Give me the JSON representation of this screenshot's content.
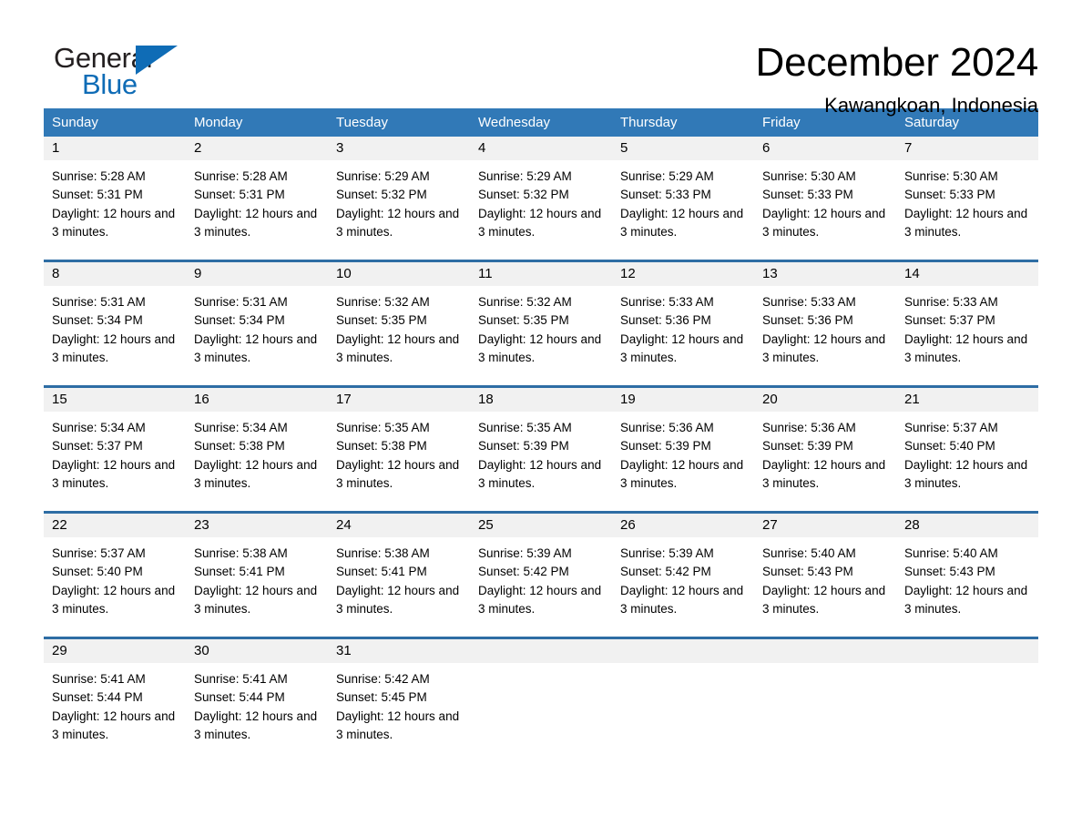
{
  "brand": {
    "name_part1": "General",
    "name_part2": "Blue",
    "triangle_color": "#0f6cb6"
  },
  "header": {
    "month_title": "December 2024",
    "location": "Kawangkoan, Indonesia"
  },
  "theme": {
    "header_blue": "#3179b7",
    "row_divider_blue": "#2e6da4",
    "date_band_gray": "#f1f1f1",
    "brand_blue": "#0f6cb6"
  },
  "calendar": {
    "day_headers": [
      "Sunday",
      "Monday",
      "Tuesday",
      "Wednesday",
      "Thursday",
      "Friday",
      "Saturday"
    ],
    "weeks": [
      {
        "days": [
          {
            "num": "1",
            "sunrise": "Sunrise: 5:28 AM",
            "sunset": "Sunset: 5:31 PM",
            "daylight": "Daylight: 12 hours and 3 minutes."
          },
          {
            "num": "2",
            "sunrise": "Sunrise: 5:28 AM",
            "sunset": "Sunset: 5:31 PM",
            "daylight": "Daylight: 12 hours and 3 minutes."
          },
          {
            "num": "3",
            "sunrise": "Sunrise: 5:29 AM",
            "sunset": "Sunset: 5:32 PM",
            "daylight": "Daylight: 12 hours and 3 minutes."
          },
          {
            "num": "4",
            "sunrise": "Sunrise: 5:29 AM",
            "sunset": "Sunset: 5:32 PM",
            "daylight": "Daylight: 12 hours and 3 minutes."
          },
          {
            "num": "5",
            "sunrise": "Sunrise: 5:29 AM",
            "sunset": "Sunset: 5:33 PM",
            "daylight": "Daylight: 12 hours and 3 minutes."
          },
          {
            "num": "6",
            "sunrise": "Sunrise: 5:30 AM",
            "sunset": "Sunset: 5:33 PM",
            "daylight": "Daylight: 12 hours and 3 minutes."
          },
          {
            "num": "7",
            "sunrise": "Sunrise: 5:30 AM",
            "sunset": "Sunset: 5:33 PM",
            "daylight": "Daylight: 12 hours and 3 minutes."
          }
        ]
      },
      {
        "days": [
          {
            "num": "8",
            "sunrise": "Sunrise: 5:31 AM",
            "sunset": "Sunset: 5:34 PM",
            "daylight": "Daylight: 12 hours and 3 minutes."
          },
          {
            "num": "9",
            "sunrise": "Sunrise: 5:31 AM",
            "sunset": "Sunset: 5:34 PM",
            "daylight": "Daylight: 12 hours and 3 minutes."
          },
          {
            "num": "10",
            "sunrise": "Sunrise: 5:32 AM",
            "sunset": "Sunset: 5:35 PM",
            "daylight": "Daylight: 12 hours and 3 minutes."
          },
          {
            "num": "11",
            "sunrise": "Sunrise: 5:32 AM",
            "sunset": "Sunset: 5:35 PM",
            "daylight": "Daylight: 12 hours and 3 minutes."
          },
          {
            "num": "12",
            "sunrise": "Sunrise: 5:33 AM",
            "sunset": "Sunset: 5:36 PM",
            "daylight": "Daylight: 12 hours and 3 minutes."
          },
          {
            "num": "13",
            "sunrise": "Sunrise: 5:33 AM",
            "sunset": "Sunset: 5:36 PM",
            "daylight": "Daylight: 12 hours and 3 minutes."
          },
          {
            "num": "14",
            "sunrise": "Sunrise: 5:33 AM",
            "sunset": "Sunset: 5:37 PM",
            "daylight": "Daylight: 12 hours and 3 minutes."
          }
        ]
      },
      {
        "days": [
          {
            "num": "15",
            "sunrise": "Sunrise: 5:34 AM",
            "sunset": "Sunset: 5:37 PM",
            "daylight": "Daylight: 12 hours and 3 minutes."
          },
          {
            "num": "16",
            "sunrise": "Sunrise: 5:34 AM",
            "sunset": "Sunset: 5:38 PM",
            "daylight": "Daylight: 12 hours and 3 minutes."
          },
          {
            "num": "17",
            "sunrise": "Sunrise: 5:35 AM",
            "sunset": "Sunset: 5:38 PM",
            "daylight": "Daylight: 12 hours and 3 minutes."
          },
          {
            "num": "18",
            "sunrise": "Sunrise: 5:35 AM",
            "sunset": "Sunset: 5:39 PM",
            "daylight": "Daylight: 12 hours and 3 minutes."
          },
          {
            "num": "19",
            "sunrise": "Sunrise: 5:36 AM",
            "sunset": "Sunset: 5:39 PM",
            "daylight": "Daylight: 12 hours and 3 minutes."
          },
          {
            "num": "20",
            "sunrise": "Sunrise: 5:36 AM",
            "sunset": "Sunset: 5:39 PM",
            "daylight": "Daylight: 12 hours and 3 minutes."
          },
          {
            "num": "21",
            "sunrise": "Sunrise: 5:37 AM",
            "sunset": "Sunset: 5:40 PM",
            "daylight": "Daylight: 12 hours and 3 minutes."
          }
        ]
      },
      {
        "days": [
          {
            "num": "22",
            "sunrise": "Sunrise: 5:37 AM",
            "sunset": "Sunset: 5:40 PM",
            "daylight": "Daylight: 12 hours and 3 minutes."
          },
          {
            "num": "23",
            "sunrise": "Sunrise: 5:38 AM",
            "sunset": "Sunset: 5:41 PM",
            "daylight": "Daylight: 12 hours and 3 minutes."
          },
          {
            "num": "24",
            "sunrise": "Sunrise: 5:38 AM",
            "sunset": "Sunset: 5:41 PM",
            "daylight": "Daylight: 12 hours and 3 minutes."
          },
          {
            "num": "25",
            "sunrise": "Sunrise: 5:39 AM",
            "sunset": "Sunset: 5:42 PM",
            "daylight": "Daylight: 12 hours and 3 minutes."
          },
          {
            "num": "26",
            "sunrise": "Sunrise: 5:39 AM",
            "sunset": "Sunset: 5:42 PM",
            "daylight": "Daylight: 12 hours and 3 minutes."
          },
          {
            "num": "27",
            "sunrise": "Sunrise: 5:40 AM",
            "sunset": "Sunset: 5:43 PM",
            "daylight": "Daylight: 12 hours and 3 minutes."
          },
          {
            "num": "28",
            "sunrise": "Sunrise: 5:40 AM",
            "sunset": "Sunset: 5:43 PM",
            "daylight": "Daylight: 12 hours and 3 minutes."
          }
        ]
      },
      {
        "days": [
          {
            "num": "29",
            "sunrise": "Sunrise: 5:41 AM",
            "sunset": "Sunset: 5:44 PM",
            "daylight": "Daylight: 12 hours and 3 minutes."
          },
          {
            "num": "30",
            "sunrise": "Sunrise: 5:41 AM",
            "sunset": "Sunset: 5:44 PM",
            "daylight": "Daylight: 12 hours and 3 minutes."
          },
          {
            "num": "31",
            "sunrise": "Sunrise: 5:42 AM",
            "sunset": "Sunset: 5:45 PM",
            "daylight": "Daylight: 12 hours and 3 minutes."
          },
          {
            "num": "",
            "sunrise": "",
            "sunset": "",
            "daylight": ""
          },
          {
            "num": "",
            "sunrise": "",
            "sunset": "",
            "daylight": ""
          },
          {
            "num": "",
            "sunrise": "",
            "sunset": "",
            "daylight": ""
          },
          {
            "num": "",
            "sunrise": "",
            "sunset": "",
            "daylight": ""
          }
        ]
      }
    ]
  }
}
